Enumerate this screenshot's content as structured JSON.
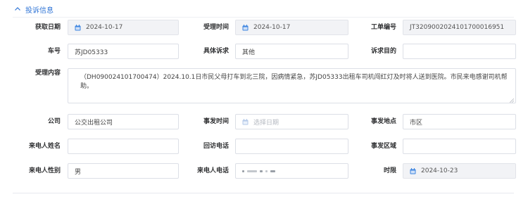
{
  "section": {
    "title": "投诉信息"
  },
  "form": {
    "row1": {
      "acquire_date_label": "获取日期",
      "acquire_date_value": "2024-10-17",
      "accept_time_label": "受理时间",
      "accept_time_value": "2024-10-17",
      "work_order_label": "工单编号",
      "work_order_value": "JT320900202410170001695​1"
    },
    "row2": {
      "plate_label": "车号",
      "plate_value": "苏JD05333",
      "request_label": "具体诉求",
      "request_value": "其他",
      "purpose_label": "诉求目的",
      "purpose_value": ""
    },
    "row3": {
      "content_label": "受理内容",
      "content_value": "（DH090024101700474）2024.10.1日市民父母打车到北三院，因病情紧急，苏JD05333出租车司机闯红灯及时将人送到医院。市民来电感谢司机帮助。"
    },
    "row4": {
      "company_label": "公司",
      "company_value": "公交出租公司",
      "incident_time_label": "事发时间",
      "incident_time_placeholder": "选择日期",
      "incident_place_label": "事发地点",
      "incident_place_value": "市区"
    },
    "row5": {
      "caller_name_label": "来电人姓名",
      "caller_name_value": "",
      "callback_phone_label": "回访电话",
      "callback_phone_value": "",
      "incident_area_label": "事发区域",
      "incident_area_value": ""
    },
    "row6": {
      "caller_gender_label": "来电人性别",
      "caller_gender_value": "男",
      "caller_phone_label": "来电人电话",
      "deadline_label": "时限",
      "deadline_value": "2024-10-23"
    }
  },
  "icons": {
    "collapse": "chevron-up-icon",
    "calendar": "calendar-icon"
  },
  "colors": {
    "accent": "#2f74d6",
    "border": "#dcdfe6",
    "disabled_bg": "#f2f3f6"
  }
}
